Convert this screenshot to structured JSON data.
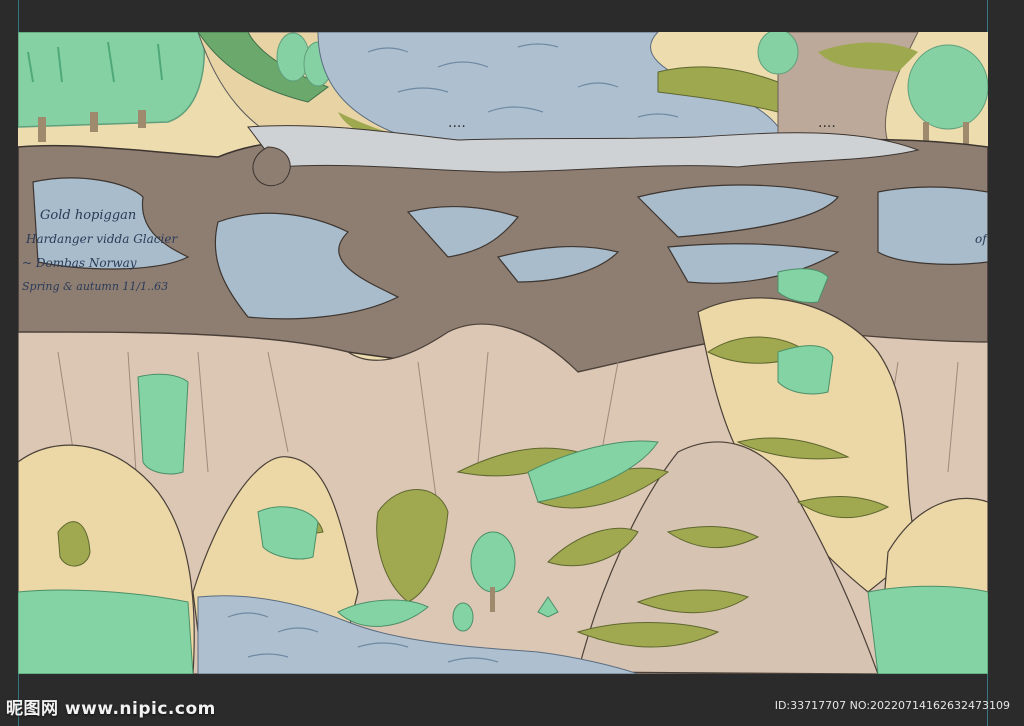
{
  "watermark": {
    "logo_text": "昵图网 www.nipic.com"
  },
  "caption": {
    "id_text": "ID:33717707 NO:20220714162632473109"
  },
  "map_annotation": {
    "lines": [
      "Gold hopiggan",
      "Hardanger vidda Glacier",
      "~ Dombas Norway",
      "Spring & autumn 11/1..63"
    ]
  },
  "palette": {
    "frame_bg": "#2b2b2b",
    "guide": "#3fb6c8",
    "water": "#a9bccb",
    "rock_brown": "#8d7d72",
    "sand": "#ead7a8",
    "cliff_pink": "#dcc7b8",
    "moss": "#9ea84f",
    "tree_green": "#7fd3a6"
  }
}
